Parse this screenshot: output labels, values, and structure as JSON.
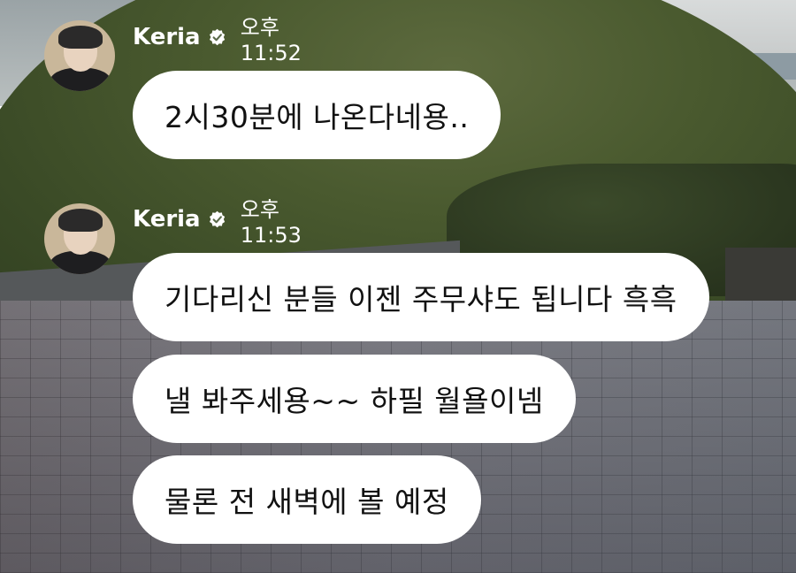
{
  "messages": [
    {
      "sender": "Keria",
      "time": "오후 11:52",
      "bubbles": [
        "2시30분에 나온다네용.."
      ]
    },
    {
      "sender": "Keria",
      "time": "오후 11:53",
      "bubbles": [
        "기다리신 분들 이젠 주무샤도 됩니다 흑흑",
        "낼 봐주세용~~ 하필 월욜이넴",
        "물론 전 새벽에 볼 예정"
      ]
    }
  ],
  "icons": {
    "verified": "verified-badge-icon",
    "avatar": "profile-avatar"
  },
  "colors": {
    "bubble": "#ffffff",
    "text": "#111111",
    "header_text": "#ffffff"
  }
}
